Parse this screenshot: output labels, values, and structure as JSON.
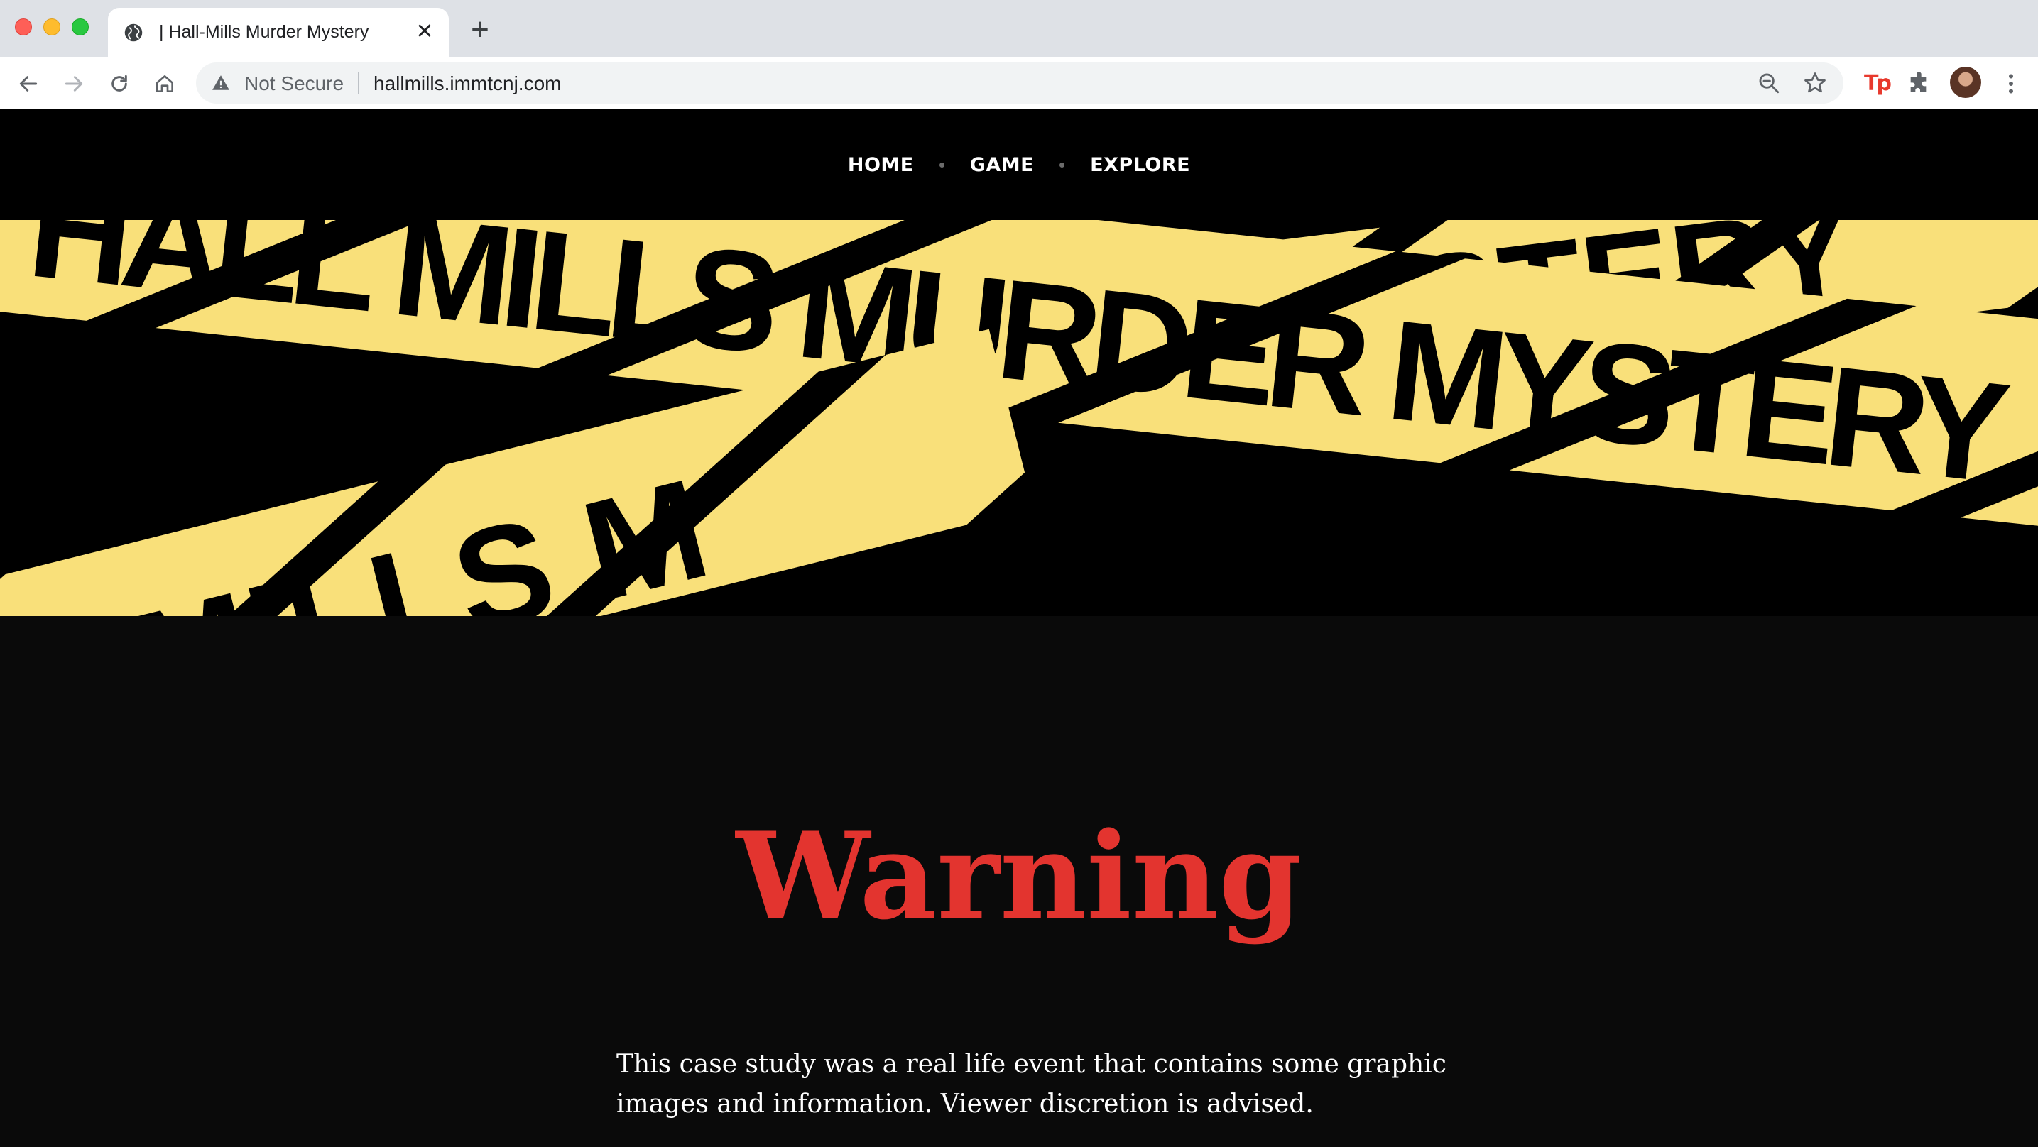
{
  "browser": {
    "tab": {
      "title": "| Hall-Mills Murder Mystery",
      "favicon": "globe-icon",
      "close": "✕"
    },
    "new_tab": "+",
    "address_bar": {
      "security_label": "Not Secure",
      "url": "hallmills.immtcnj.com"
    },
    "extensions": {
      "tp_label": "Tp"
    }
  },
  "site": {
    "nav": {
      "items": [
        "HOME",
        "GAME",
        "EXPLORE"
      ]
    },
    "hero": {
      "banner_main": "HALL MILLS MURDER MYSTERY",
      "banner_back": "MYSTERY",
      "banner_front": "MILLS M",
      "colors": {
        "tape": "#f9e07a",
        "ink": "#000000"
      }
    },
    "warning": {
      "title": "Warning",
      "text": "This case study was a real life event that contains some graphic images and information. Viewer discretion is advised.",
      "title_color": "#e3342f"
    }
  }
}
